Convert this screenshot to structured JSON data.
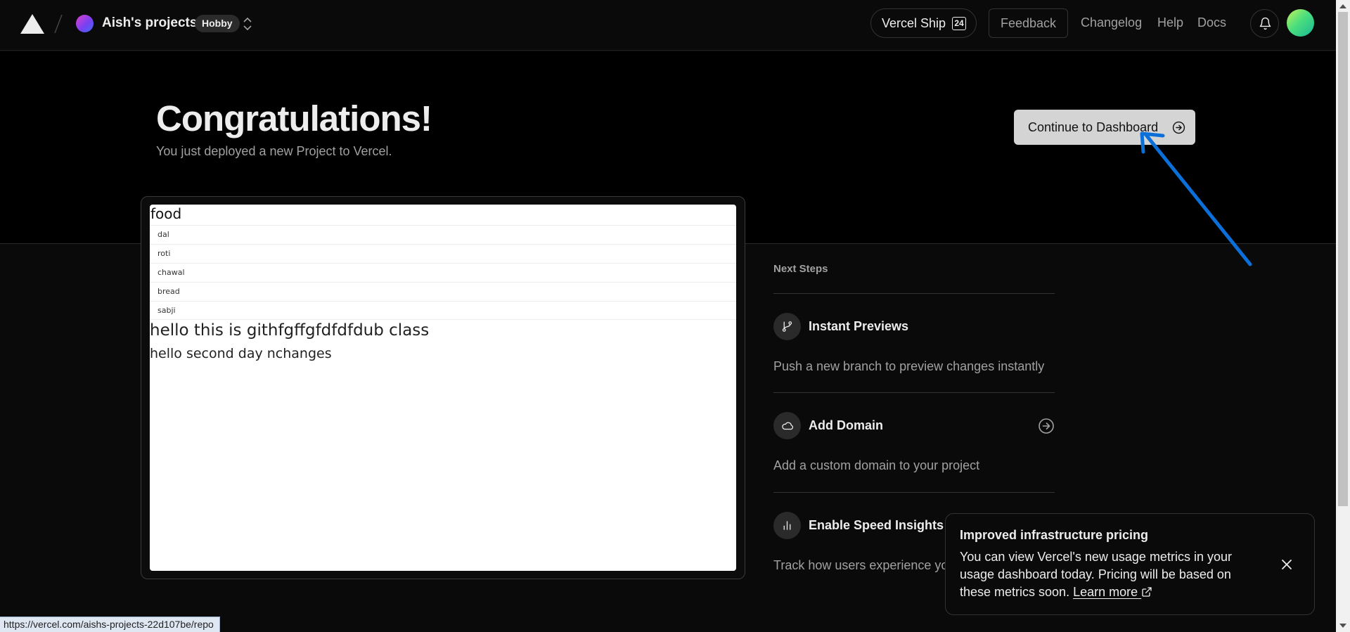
{
  "nav": {
    "team_name": "Aish's projects",
    "plan_badge": "Hobby",
    "ship_label": "Vercel Ship",
    "ship_badge": "24",
    "feedback_label": "Feedback",
    "links": [
      "Changelog",
      "Help",
      "Docs"
    ]
  },
  "hero": {
    "title": "Congratulations!",
    "subtitle": "You just deployed a new Project to Vercel.",
    "continue_label": "Continue to Dashboard"
  },
  "preview": {
    "heading": "food",
    "items": [
      "dal",
      "roti",
      "chawal",
      "bread",
      "sabji"
    ],
    "line1": "hello this is githfgffgfdfdfdub class",
    "line2": "hello second day nchanges"
  },
  "next_steps": {
    "label": "Next Steps",
    "steps": [
      {
        "title": "Instant Previews",
        "description": "Push a new branch to preview changes instantly",
        "icon": "git-branch-icon"
      },
      {
        "title": "Add Domain",
        "description": "Add a custom domain to your project",
        "icon": "cloud-icon"
      },
      {
        "title": "Enable Speed Insights",
        "description": "Track how users experience yo",
        "icon": "bar-chart-icon"
      }
    ]
  },
  "toast": {
    "title": "Improved infrastructure pricing",
    "body": "You can view Vercel's new usage metrics in your usage dashboard today. Pricing will be based on these metrics soon.",
    "link": "Learn more"
  },
  "status_url": "https://vercel.com/aishs-projects-22d107be/repo",
  "colors": {
    "background": "#0a0a0a",
    "hero_background": "#000000",
    "continue_button": "#d4d4d4",
    "annotation_arrow": "#0a6fd8",
    "text_muted": "#a1a1a1"
  }
}
